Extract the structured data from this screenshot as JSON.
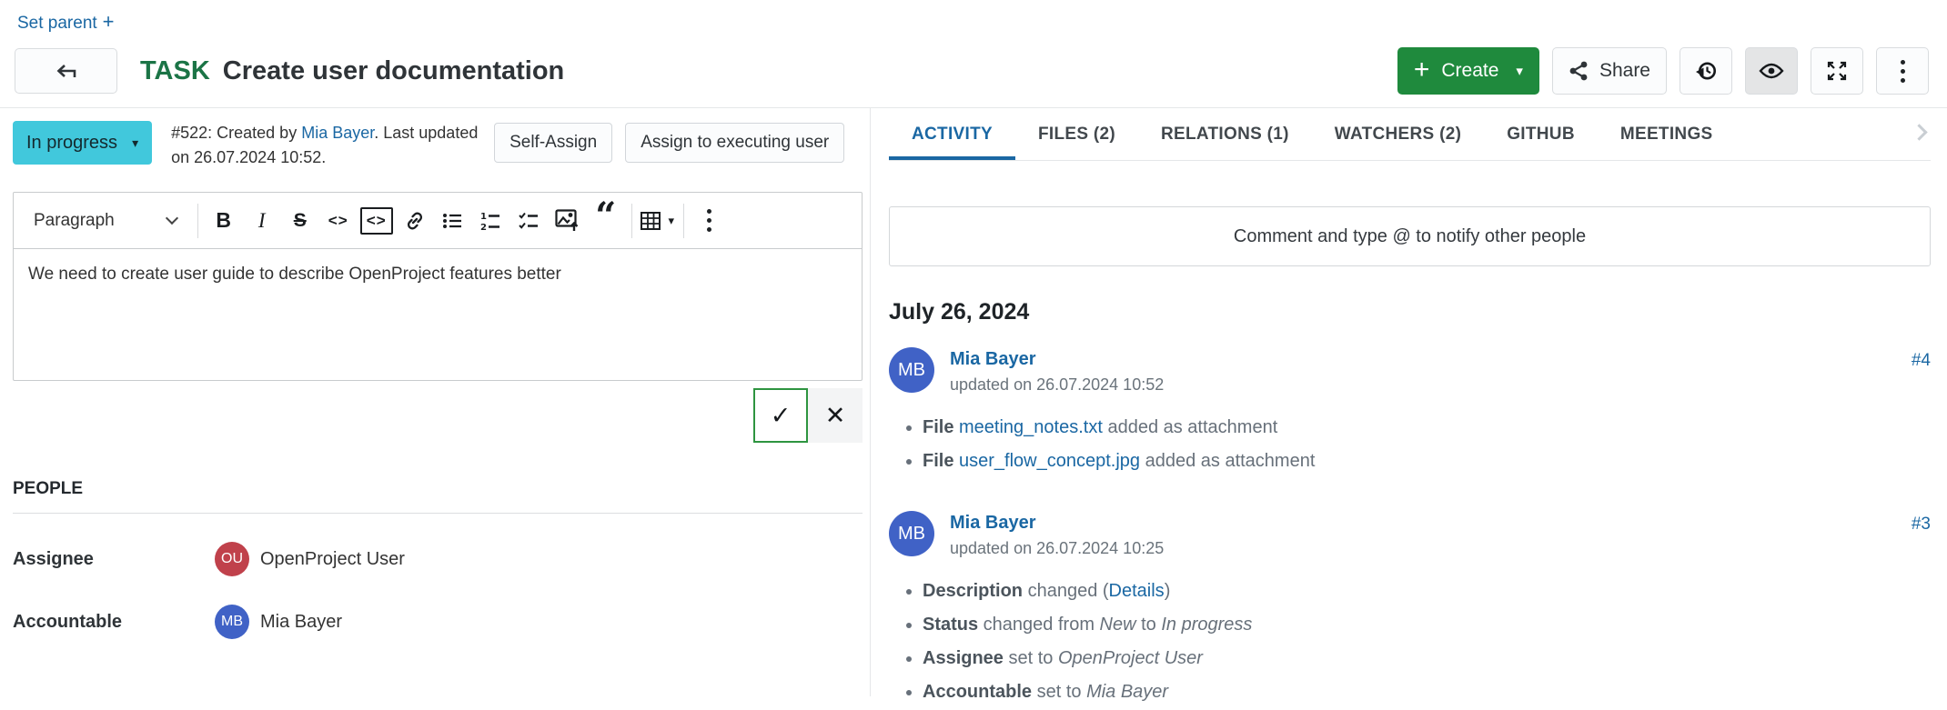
{
  "colors": {
    "link": "#1A67A3",
    "task_green": "#1B7446",
    "create_green": "#1F8A3D",
    "status_cyan": "#41C8DC",
    "avatar_red": "#C0414B",
    "avatar_blue": "#4062C6",
    "tab_active": "#1A67A3"
  },
  "icons": {
    "plus": "+",
    "caret": "▾",
    "check": "✓",
    "close": "✕",
    "quote": "“",
    "bold_glyph": "B",
    "italic_glyph": "I",
    "strike_glyph": "S",
    "inline_code_glyph": "<>",
    "code_block_glyph": "<>"
  },
  "top": {
    "set_parent_label": "Set parent"
  },
  "header": {
    "type_label": "TASK",
    "title": "Create user documentation",
    "create_label": "Create",
    "share_label": "Share"
  },
  "status_row": {
    "status": "In progress",
    "meta_prefix": "#522: Created by ",
    "meta_author": "Mia Bayer",
    "meta_suffix": ". Last updated on 26.07.2024 10:52.",
    "self_assign_label": "Self-Assign",
    "assign_executing_label": "Assign to executing user"
  },
  "editor": {
    "paragraph_label": "Paragraph",
    "content": "We need to create user guide to describe OpenProject features better"
  },
  "people": {
    "section_label": "PEOPLE",
    "assignee_label": "Assignee",
    "assignee_initials": "OU",
    "assignee_name": "OpenProject User",
    "accountable_label": "Accountable",
    "accountable_initials": "MB",
    "accountable_name": "Mia Bayer"
  },
  "tabs": [
    {
      "label": "ACTIVITY",
      "active": true
    },
    {
      "label": "FILES (2)",
      "active": false
    },
    {
      "label": "RELATIONS (1)",
      "active": false
    },
    {
      "label": "WATCHERS (2)",
      "active": false
    },
    {
      "label": "GITHUB",
      "active": false
    },
    {
      "label": "MEETINGS",
      "active": false
    }
  ],
  "activity": {
    "comment_placeholder": "Comment and type @ to notify other people",
    "date_header": "July 26, 2024",
    "entries": [
      {
        "initials": "MB",
        "author": "Mia Bayer",
        "updated": "updated on 26.07.2024 10:52",
        "ref": "#4",
        "items": [
          [
            {
              "text": "File ",
              "style": "bold"
            },
            {
              "text": "meeting_notes.txt",
              "style": "link"
            },
            {
              "text": " added as attachment",
              "style": "plain"
            }
          ],
          [
            {
              "text": "File ",
              "style": "bold"
            },
            {
              "text": "user_flow_concept.jpg",
              "style": "link"
            },
            {
              "text": " added as attachment",
              "style": "plain"
            }
          ]
        ]
      },
      {
        "initials": "MB",
        "author": "Mia Bayer",
        "updated": "updated on 26.07.2024 10:25",
        "ref": "#3",
        "items": [
          [
            {
              "text": "Description",
              "style": "bold"
            },
            {
              "text": " changed (",
              "style": "plain"
            },
            {
              "text": "Details",
              "style": "link"
            },
            {
              "text": ")",
              "style": "plain"
            }
          ],
          [
            {
              "text": "Status",
              "style": "bold"
            },
            {
              "text": " changed from ",
              "style": "plain"
            },
            {
              "text": "New",
              "style": "italic"
            },
            {
              "text": " to ",
              "style": "plain"
            },
            {
              "text": "In progress",
              "style": "italic"
            }
          ],
          [
            {
              "text": "Assignee",
              "style": "bold"
            },
            {
              "text": " set to ",
              "style": "plain"
            },
            {
              "text": "OpenProject User",
              "style": "italic"
            }
          ],
          [
            {
              "text": "Accountable",
              "style": "bold"
            },
            {
              "text": " set to ",
              "style": "plain"
            },
            {
              "text": "Mia Bayer",
              "style": "italic"
            }
          ]
        ]
      }
    ]
  }
}
